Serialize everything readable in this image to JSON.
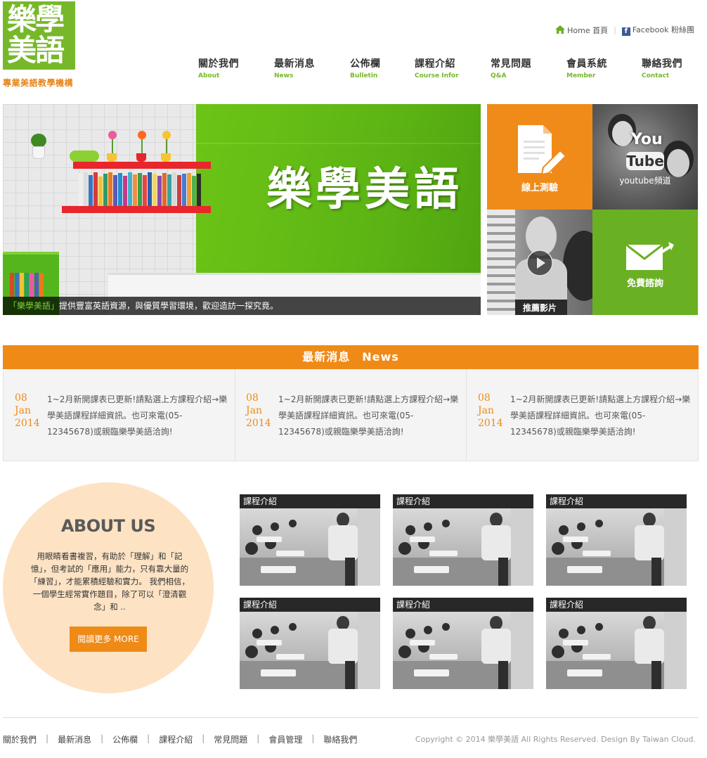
{
  "brand": {
    "logo_text": "樂學美語",
    "tagline": "專業美語教學機構"
  },
  "top_links": {
    "home": "Home 首頁",
    "facebook": "Facebook 粉絲團"
  },
  "nav": [
    {
      "zh": "關於我們",
      "en": "About"
    },
    {
      "zh": "最新消息",
      "en": "News"
    },
    {
      "zh": "公佈欄",
      "en": "Bulletin"
    },
    {
      "zh": "課程介紹",
      "en": "Course Infor"
    },
    {
      "zh": "常見問題",
      "en": "Q&A"
    },
    {
      "zh": "會員系統",
      "en": "Member"
    },
    {
      "zh": "聯絡我們",
      "en": "Contact"
    }
  ],
  "hero": {
    "brand_sign": "樂學美語",
    "caption_highlight": "「樂學美語」",
    "caption_rest": "提供豐富英語資源，與優質學習環境，歡迎造訪一探究竟。"
  },
  "tiles": {
    "test": "線上測驗",
    "youtube_logo_top": "You",
    "youtube_logo_bottom": "Tube",
    "youtube": "youtube頻道",
    "video": "推薦影片",
    "contact": "免費諮詢"
  },
  "news": {
    "title": "最新消息　News",
    "items": [
      {
        "day": "08",
        "month": "Jan",
        "year": "2014",
        "text": "1~2月新開課表已更新!請點選上方課程介紹→樂學美語課程詳細資訊。也可來電(05-12345678)或親臨樂學美語洽詢!"
      },
      {
        "day": "08",
        "month": "Jan",
        "year": "2014",
        "text": "1~2月新開課表已更新!請點選上方課程介紹→樂學美語課程詳細資訊。也可來電(05-12345678)或親臨樂學美語洽詢!"
      },
      {
        "day": "08",
        "month": "Jan",
        "year": "2014",
        "text": "1~2月新開課表已更新!請點選上方課程介紹→樂學美語課程詳細資訊。也可來電(05-12345678)或親臨樂學美語洽詢!"
      }
    ]
  },
  "about": {
    "title": "ABOUT US",
    "text": "用眼睛看書複習，有助於「理解」和「記憶」，但考試的「應用」能力，只有靠大量的「練習」，才能累積經驗和實力。 我們相信，一個學生經常實作題目，除了可以「澄清觀念」和 ..",
    "button": "閱讀更多 MORE"
  },
  "courses": [
    {
      "label": "課程介紹"
    },
    {
      "label": "課程介紹"
    },
    {
      "label": "課程介紹"
    },
    {
      "label": "課程介紹"
    },
    {
      "label": "課程介紹"
    },
    {
      "label": "課程介紹"
    }
  ],
  "footer": {
    "links": [
      "關於我們",
      "最新消息",
      "公佈欄",
      "課程介紹",
      "常見問題",
      "會員管理",
      "聯絡我們"
    ],
    "copyright": "Copyright © 2014 樂學美語 All Rights Reserved. Design By Taiwan Cloud."
  },
  "colors": {
    "brand_green": "#76b82a",
    "brand_orange": "#ef8a17",
    "about_bg": "#fde3c4"
  }
}
